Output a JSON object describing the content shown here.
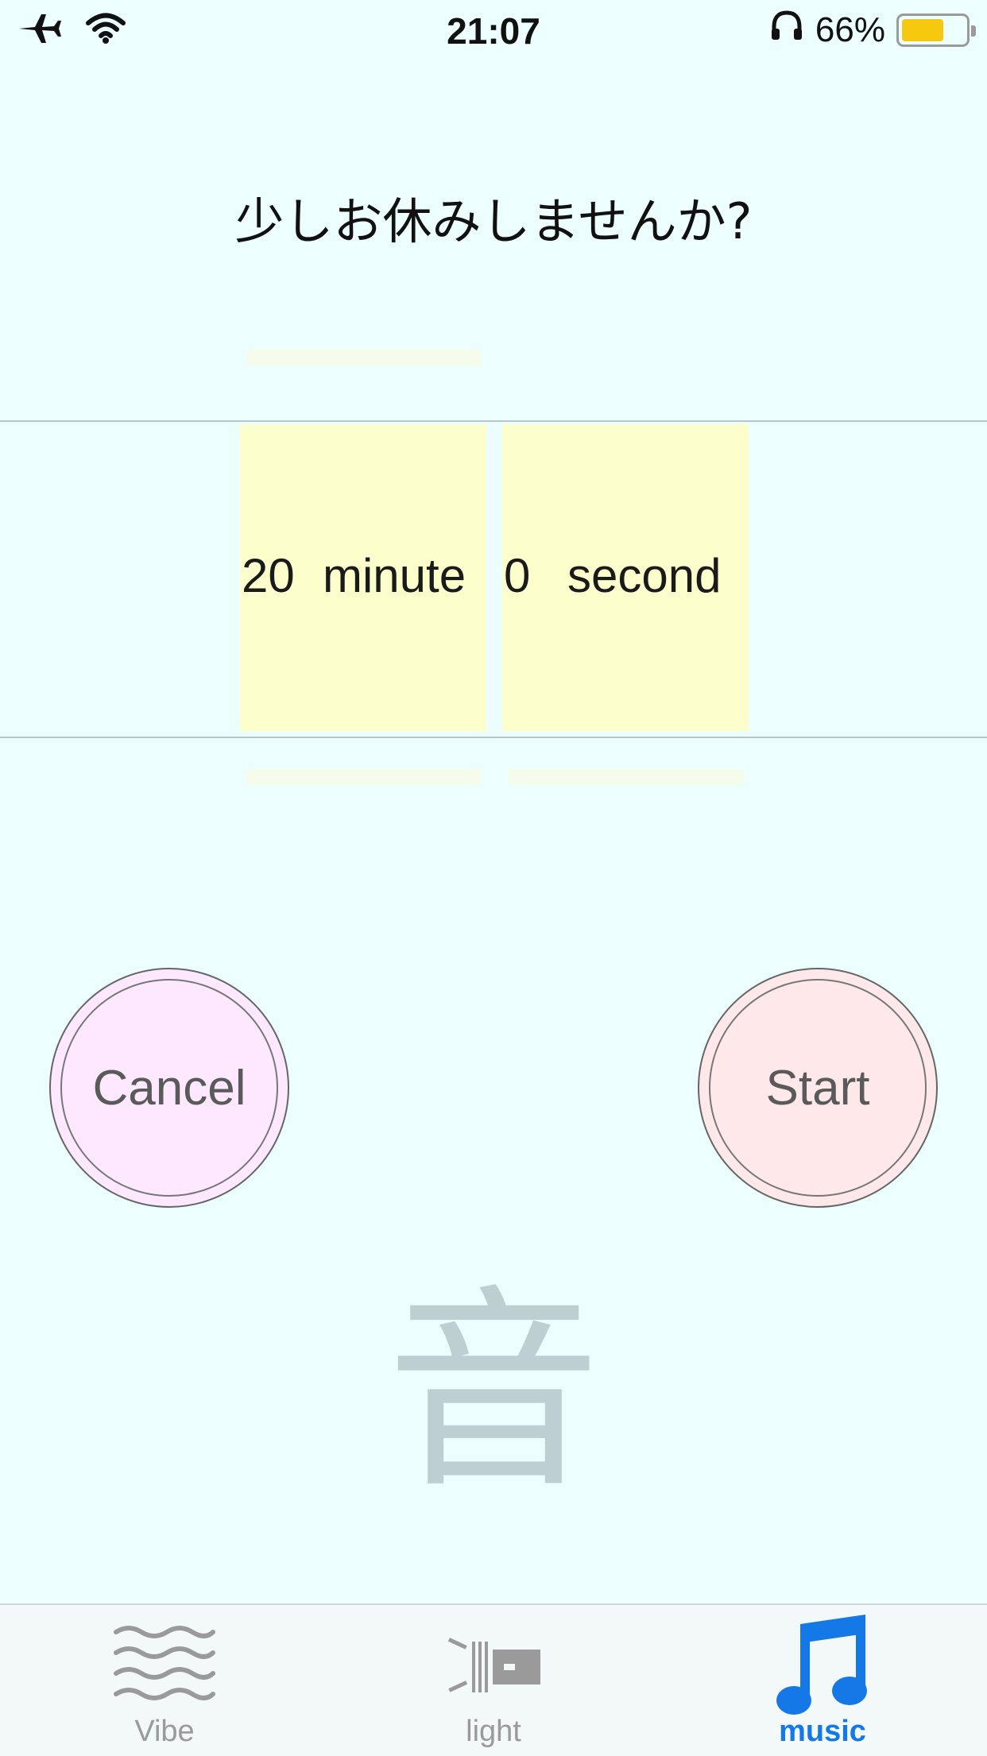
{
  "status_bar": {
    "time": "21:07",
    "battery_percent": "66%",
    "battery_level": 0.66,
    "icons": [
      "airplane-icon",
      "wifi-icon",
      "headphones-icon",
      "battery-icon"
    ]
  },
  "prompt": "少しお休みしませんか?",
  "picker": {
    "minutes_value": "20",
    "minutes_unit": "minute",
    "seconds_value": "0",
    "seconds_unit": "second"
  },
  "buttons": {
    "cancel": "Cancel",
    "start": "Start"
  },
  "mode_symbol": "音",
  "tabs": [
    {
      "label": "Vibe",
      "icon": "waves-icon",
      "active": false
    },
    {
      "label": "light",
      "icon": "flashlight-icon",
      "active": false
    },
    {
      "label": "music",
      "icon": "music-note-icon",
      "active": true
    }
  ],
  "colors": {
    "background": "#ecfefe",
    "picker_column": "#fcffcc",
    "cancel_fill": "#fde8ff",
    "start_fill": "#ffe8ea",
    "active_tab": "#1479e6",
    "inactive_tab": "#9a9a9a"
  }
}
